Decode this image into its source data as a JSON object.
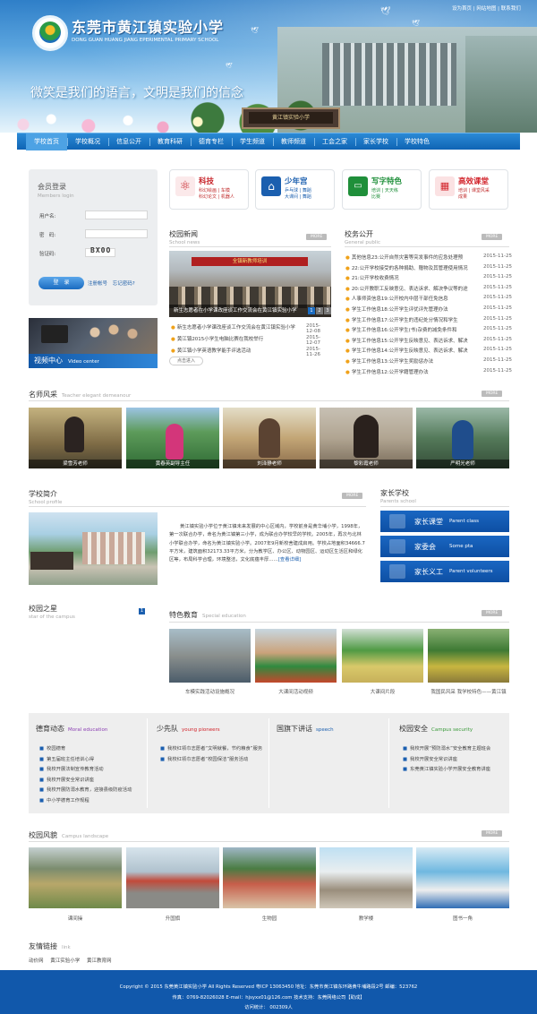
{
  "header": {
    "school_cn": "东莞市黄江镇实验小学",
    "school_en": "DONG GUAN HUANG JIANG EPERIMENTAL PRIMARY SCHOOL",
    "slogan": "微笑是我们的语言，文明是我们的信念",
    "gate_sign": "黄江镇实验小学",
    "top_links": "设为首页 | 网站地图 | 联系我们"
  },
  "nav": [
    "学校首页",
    "学校概况",
    "信息公开",
    "教育科研",
    "德育专栏",
    "学生频道",
    "教师频道",
    "工会之家",
    "家长学校",
    "学校特色"
  ],
  "login": {
    "title": "会员登录",
    "subtitle": "Members login",
    "username": "用户名:",
    "password": "密　码:",
    "captcha_label": "验证码:",
    "captcha": "BX0O",
    "button": "登　录",
    "register": "注册帐号",
    "forgot": "忘记密码?"
  },
  "video": {
    "title": "视频中心",
    "subtitle": "Video center"
  },
  "features": [
    {
      "title": "科技",
      "links": "科幻绘画 | 车模\n科幻论文 | 机器人",
      "color": "#c8272d"
    },
    {
      "title": "少年宫",
      "links": "乒乓球 | 舞蹈\n大课间 | 舞蹈",
      "color": "#1b5faf"
    },
    {
      "title": "写字特色",
      "links": "培训 | 天天练\n比赛",
      "color": "#1f8f3a"
    },
    {
      "title": "高效课堂",
      "links": "培训 | 课堂风采\n成果",
      "color": "#d2232a"
    }
  ],
  "school_news": {
    "title": "校园新闻",
    "subtitle": "School news",
    "more": "MORE",
    "photo_banner": "全镇新教师培训",
    "caption": "新生志愿者在小学课改座谈工作交流会在黄江镇实验小学",
    "pages": [
      "1",
      "2",
      "3"
    ],
    "items": [
      {
        "t": "新生志愿者小学课改座谈工作交流会在黄江镇实验小学",
        "d": "2015-12-08"
      },
      {
        "t": "黄江镇2015小学生电脑比赛在我校举行",
        "d": "2015-12-07"
      },
      {
        "t": "黄江镇小学英语教学能手评选活动",
        "d": "2015-11-26"
      }
    ],
    "load_more": "点击进入"
  },
  "disclosure": {
    "title": "校务公开",
    "subtitle": "General public",
    "more": "MORE",
    "items": [
      {
        "t": "其他信息23:公开自然灾害等突发事件的应急处理预",
        "d": "2015-11-25"
      },
      {
        "t": "22:公开学校接受的各种捐助、赠物及其管理使用情况",
        "d": "2015-11-25"
      },
      {
        "t": "21:公开学校收费情况",
        "d": "2015-11-25"
      },
      {
        "t": "20:公开教职工反映意见、表达诉求、解决争议等的途",
        "d": "2015-11-25"
      },
      {
        "t": "人事师资信息19:公开校内中层干部任免信息",
        "d": "2015-11-25"
      },
      {
        "t": "学生工作信息18:公开学生评优评先管理办法",
        "d": "2015-11-25"
      },
      {
        "t": "学生工作信息17:公开学生的违纪处分情况和学生",
        "d": "2015-11-25"
      },
      {
        "t": "学生工作信息16:公开学生(书)杂费的减免条件和",
        "d": "2015-11-25"
      },
      {
        "t": "学生工作信息15:公开学生反映意见、表达诉求、解决",
        "d": "2015-11-25"
      },
      {
        "t": "学生工作信息14:公开学生反映意见、表达诉求、解决",
        "d": "2015-11-25"
      },
      {
        "t": "学生工作信息13:公开学生奖励惩办法",
        "d": "2015-11-25"
      },
      {
        "t": "学生工作信息12:公开学籍管理办法",
        "d": "2015-11-25"
      }
    ]
  },
  "teachers": {
    "title": "名师风采",
    "subtitle": "Teacher elegant demeanour",
    "more": "MORE",
    "items": [
      "梁雪芳老师",
      "黄春英副导主任",
      "刘泽静老师",
      "黎彩霞老师",
      "严明光老师"
    ]
  },
  "profile": {
    "title": "学校简介",
    "subtitle": "School profile",
    "more": "MORE",
    "text": "黄江镇实验小学位于黄江镇未来发展的中心区域内，学校前身是黄华埔小学，1998年，第一次联合办学，命名为黄江镇第三小学，成为联合办学较早的学校。2005年，再次与北林小学联合办学，命名为黄江镇实验小学。2007年9月新校舍建成启用。学校占地面积34666.7平方米，建筑面积32173.33平方米，分为教学区、办公区、动物园区、运动区生活区和绿化区等，布局科学合理，环境整洁，文化底蕴丰厚……",
    "read_more": "[查看详细]"
  },
  "parents": {
    "title": "家长学校",
    "subtitle": "Parents school",
    "items": [
      {
        "cn": "家长课堂",
        "en": "Parent class"
      },
      {
        "cn": "家委会",
        "en": "Some pta"
      },
      {
        "cn": "家长义工",
        "en": "Parent volunteers"
      }
    ]
  },
  "star": {
    "title": "校园之星",
    "subtitle": "star of the campus",
    "badge": "1"
  },
  "special": {
    "title": "特色教育",
    "subtitle": "Special education",
    "more": "MORE",
    "items": [
      "车模实践活动设施概况",
      "大课间活动视频",
      "大课间片段",
      "我国民风采 我学校特色——黄江镇"
    ]
  },
  "columns": [
    {
      "title": "德育动态",
      "sub": "Moral education",
      "color": "#8b3fb3",
      "items": [
        "校园德育",
        "第五届班主任培训心得",
        "我校开展法制宣传教育活动",
        "我校开展安全常识讲座",
        "我校开展防溺水教育，迎接县级防疫活动",
        "中小学德育工作规程"
      ]
    },
    {
      "title": "少先队",
      "sub": "young pioneers",
      "color": "#d2232a",
      "items": [
        "我校红领巾志愿者“文明就餐，节约粮食”服务",
        "我校红领巾志愿者“校园保洁”服务活动"
      ]
    },
    {
      "title": "国旗下讲话",
      "sub": "speech",
      "color": "#1b5faf",
      "items": []
    },
    {
      "title": "校园安全",
      "sub": "Campus security",
      "color": "#3a9a3a",
      "items": [
        "我校开展“预防溺水”安全教育主题班会",
        "我校开展安全常识讲座",
        "东莞黄江镇实验小学开展安全教育讲座"
      ]
    }
  ],
  "campus": {
    "title": "校园风貌",
    "subtitle": "Campus landscape",
    "more": "MORE",
    "items": [
      "课间操",
      "升国旗",
      "生物园",
      "教学楼",
      "图书一角"
    ]
  },
  "links": {
    "title": "友情链接",
    "subtitle": "link",
    "items": [
      "动价网",
      "黄江实验小学",
      "黄江教育网"
    ]
  },
  "footer": {
    "line1": "Copyright © 2015 东莞黄江镇实验小学 All Rights Reserved 粤ICP 13063450 地址：东莞市黄江镇东环路黄牛埔路段2号 邮编：523762",
    "line2": "传真：0769-82026028 E-mail：hjsyxx01@126.com 技术支持：东莞网络公司【助成】",
    "line3": "访问统计：   002309人"
  }
}
